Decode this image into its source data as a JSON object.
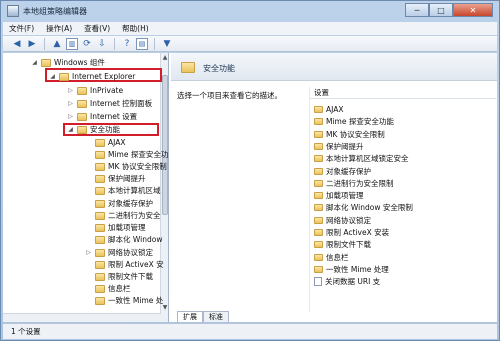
{
  "window": {
    "title": "本地组策略编辑器",
    "minimize": "─",
    "maximize": "□",
    "close": "✕"
  },
  "menu": [
    "文件(F)",
    "操作(A)",
    "查看(V)",
    "帮助(H)"
  ],
  "toolbar": {
    "icons": [
      "back-icon",
      "forward-icon",
      "up-folder-icon",
      "show-tree-icon",
      "refresh-icon",
      "export-icon",
      "help-icon",
      "properties-icon",
      "filter-icon"
    ]
  },
  "tree": {
    "items": [
      {
        "label": "Windows 组件",
        "type": "folder",
        "arrow": "◢"
      },
      {
        "label": "Internet Explorer",
        "type": "folder",
        "arrow": "◢"
      },
      {
        "label": "InPrivate",
        "type": "folder",
        "arrow": "▷"
      },
      {
        "label": "Internet 控制面板",
        "type": "folder",
        "arrow": "▷"
      },
      {
        "label": "Internet 设置",
        "type": "folder",
        "arrow": "▷"
      },
      {
        "label": "安全功能",
        "type": "folder",
        "arrow": "◢"
      },
      {
        "label": "AJAX",
        "type": "folder",
        "arrow": ""
      },
      {
        "label": "Mime 探查安全功",
        "type": "folder",
        "arrow": ""
      },
      {
        "label": "MK 协议安全限制",
        "type": "folder",
        "arrow": ""
      },
      {
        "label": "保护阈提升",
        "type": "folder",
        "arrow": ""
      },
      {
        "label": "本地计算机区域",
        "type": "folder",
        "arrow": ""
      },
      {
        "label": "对象缓存保护",
        "type": "folder",
        "arrow": ""
      },
      {
        "label": "二进制行为安全",
        "type": "folder",
        "arrow": ""
      },
      {
        "label": "加载项管理",
        "type": "folder",
        "arrow": ""
      },
      {
        "label": "脚本化 Window",
        "type": "folder",
        "arrow": ""
      },
      {
        "label": "网络协议锁定",
        "type": "folder",
        "arrow": "▷"
      },
      {
        "label": "限制 ActiveX 安",
        "type": "folder",
        "arrow": ""
      },
      {
        "label": "限制文件下载",
        "type": "folder",
        "arrow": ""
      },
      {
        "label": "信息栏",
        "type": "folder",
        "arrow": ""
      },
      {
        "label": "一致性 Mime 处",
        "type": "folder",
        "arrow": ""
      }
    ]
  },
  "right": {
    "title": "安全功能",
    "description": "选择一个项目来查看它的描述。",
    "column_header": "设置",
    "items": [
      {
        "label": "AJAX",
        "type": "folder"
      },
      {
        "label": "Mime 探查安全功能",
        "type": "folder"
      },
      {
        "label": "MK 协议安全限制",
        "type": "folder"
      },
      {
        "label": "保护阈提升",
        "type": "folder"
      },
      {
        "label": "本地计算机区域锁定安全",
        "type": "folder"
      },
      {
        "label": "对象缓存保护",
        "type": "folder"
      },
      {
        "label": "二进制行为安全限制",
        "type": "folder"
      },
      {
        "label": "加载项管理",
        "type": "folder"
      },
      {
        "label": "脚本化 Window 安全限制",
        "type": "folder"
      },
      {
        "label": "网络协议锁定",
        "type": "folder"
      },
      {
        "label": "限制 ActiveX 安装",
        "type": "folder"
      },
      {
        "label": "限制文件下载",
        "type": "folder"
      },
      {
        "label": "信息栏",
        "type": "folder"
      },
      {
        "label": "一致性 Mime 处理",
        "type": "folder"
      },
      {
        "label": "关闭数据 URI 支",
        "type": "doc"
      }
    ],
    "tabs": [
      "扩展",
      "标准"
    ]
  },
  "status": "1 个设置",
  "colors": {
    "highlight_box": "#d21d2a",
    "folder": "#e9c35c"
  }
}
